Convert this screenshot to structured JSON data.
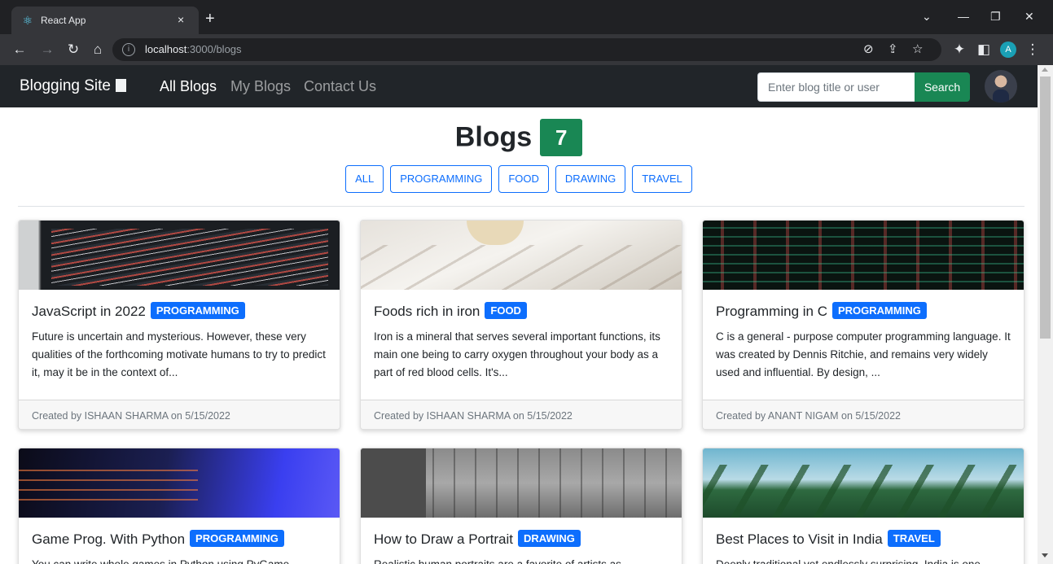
{
  "browser": {
    "tab_title": "React App",
    "tab_icon": "react-logo-icon",
    "tab_close": "×",
    "new_tab": "+",
    "url_host": "localhost",
    "url_path": ":3000/blogs",
    "profile_initial": "A",
    "window_controls": [
      "⌄",
      "—",
      "❐",
      "✕"
    ]
  },
  "navbar": {
    "brand": "Blogging Site",
    "links": [
      "All Blogs",
      "My Blogs",
      "Contact Us"
    ],
    "active_link": "All Blogs",
    "search_placeholder": "Enter blog title or user",
    "search_label": "Search"
  },
  "header": {
    "title": "Blogs",
    "count": "7",
    "filters": [
      "ALL",
      "PROGRAMMING",
      "FOOD",
      "DRAWING",
      "TRAVEL"
    ]
  },
  "colors": {
    "navbar_bg": "#212529",
    "success": "#198754",
    "primary": "#0d6efd"
  },
  "blogs": [
    {
      "title": "JavaScript in 2022",
      "category": "PROGRAMMING",
      "excerpt": "Future is uncertain and mysterious. However, these very qualities of the forthcoming motivate humans to try to predict it, may it be in the context of...",
      "footer": "Created by ISHAAN SHARMA on 5/15/2022"
    },
    {
      "title": "Foods rich in iron",
      "category": "FOOD",
      "excerpt": "Iron is a mineral that serves several important functions, its main one being to carry oxygen throughout your body as a part of red blood cells. It's...",
      "footer": "Created by ISHAAN SHARMA on 5/15/2022"
    },
    {
      "title": "Programming in C",
      "category": "PROGRAMMING",
      "excerpt": "C is a general - purpose computer programming language. It was created by Dennis Ritchie, and remains very widely used and influential. By design, ...",
      "footer": "Created by ANANT NIGAM on 5/15/2022"
    },
    {
      "title": "Game Prog. With Python",
      "category": "PROGRAMMING",
      "excerpt": "You can write whole games in Python using PyGame.",
      "footer": ""
    },
    {
      "title": "How to Draw a Portrait",
      "category": "DRAWING",
      "excerpt": "Realistic human portraits are a favorite of artists as",
      "footer": ""
    },
    {
      "title": "Best Places to Visit in India",
      "category": "TRAVEL",
      "excerpt": "Deeply traditional yet endlessly surprising, India is one",
      "footer": ""
    }
  ]
}
